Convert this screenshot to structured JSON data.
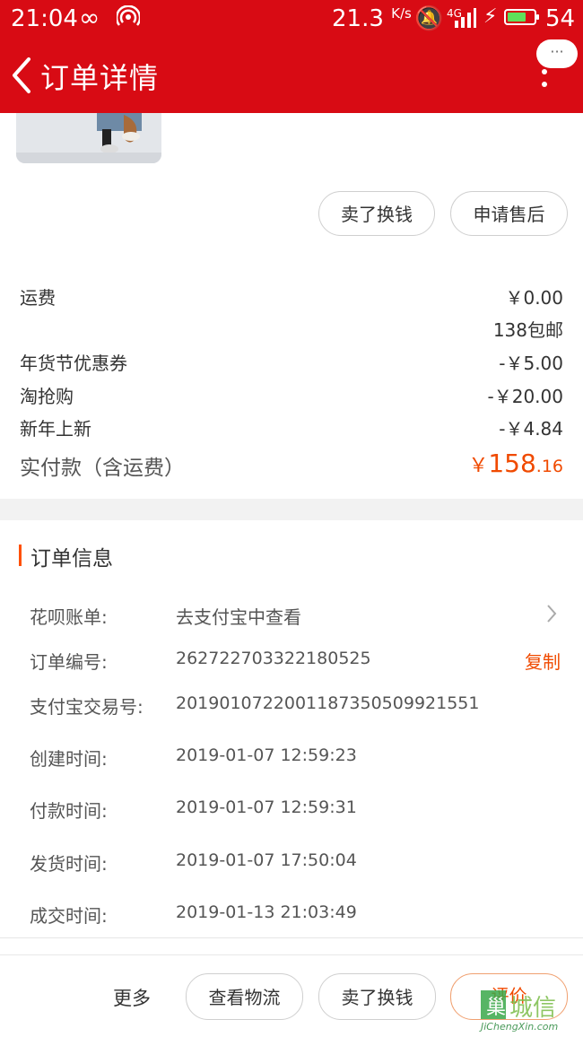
{
  "status_bar": {
    "time": "21:04",
    "speed": "21.3",
    "speed_unit": "K/s",
    "network": "4G",
    "battery": "54"
  },
  "header": {
    "title": "订单详情",
    "more_dots": "···"
  },
  "actions": {
    "sell_label": "卖了换钱",
    "after_sale_label": "申请售后"
  },
  "prices": {
    "shipping_label": "运费",
    "shipping_value": "￥0.00",
    "shipping_note": "138包邮",
    "coupon_label": "年货节优惠券",
    "coupon_value": "-￥5.00",
    "taoqiang_label": "淘抢购",
    "taoqiang_value": "-￥20.00",
    "newyear_label": "新年上新",
    "newyear_value": "-￥4.84",
    "paid_label": "实付款（含运费）",
    "paid_currency": "￥",
    "paid_integer": "158",
    "paid_decimal": ".16"
  },
  "order_info": {
    "title": "订单信息",
    "huabei_label": "花呗账单:",
    "huabei_value": "去支付宝中查看",
    "order_no_label": "订单编号:",
    "order_no_value": "262722703322180525",
    "copy_label": "复制",
    "alipay_no_label": "支付宝交易号:",
    "alipay_no_value": "2019010722001187350509921551",
    "created_label": "创建时间:",
    "created_value": "2019-01-07 12:59:23",
    "paid_time_label": "付款时间:",
    "paid_time_value": "2019-01-07 12:59:31",
    "shipped_label": "发货时间:",
    "shipped_value": "2019-01-07 17:50:04",
    "closed_label": "成交时间:",
    "closed_value": "2019-01-13 21:03:49"
  },
  "bottom_bar": {
    "more_label": "更多",
    "logistics_label": "查看物流",
    "sell_label": "卖了换钱",
    "review_label": "评价"
  },
  "watermark": {
    "text": "JiChengXin.com"
  },
  "colors": {
    "header_red": "#d80b14",
    "accent_orange": "#ff5000",
    "price_orange": "#f04a00"
  }
}
